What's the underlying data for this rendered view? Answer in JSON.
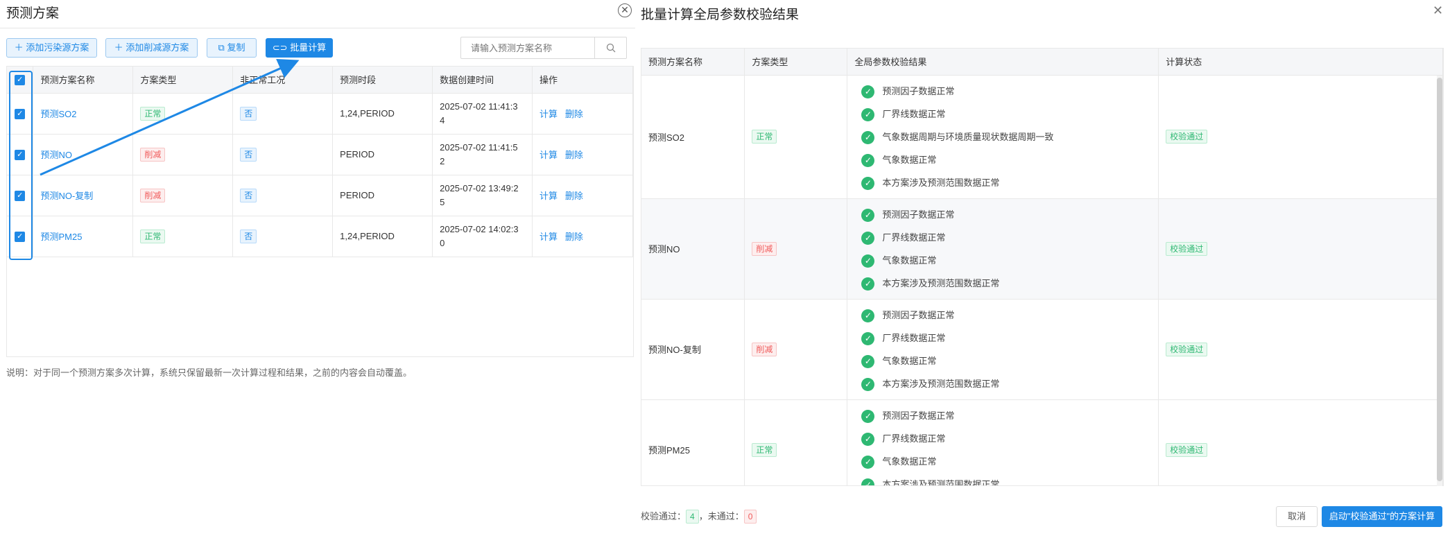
{
  "left_panel": {
    "title": "预测方案",
    "toolbar": {
      "add_pollution": "添加污染源方案",
      "add_reduction": "添加削减源方案",
      "copy": "复制",
      "batch_calc": "批量计算"
    },
    "search": {
      "placeholder": "请输入预测方案名称"
    },
    "columns": [
      "预测方案名称",
      "方案类型",
      "非正常工况",
      "预测时段",
      "数据创建时间",
      "操作"
    ],
    "rows": [
      {
        "name": "预测SO2",
        "type": "正常",
        "type_color": "green",
        "abnormal": "否",
        "period": "1,24,PERIOD",
        "created_l1": "2025-07-02 11:41:3",
        "created_l2": "4",
        "action_calc": "计算",
        "action_delete": "删除"
      },
      {
        "name": "预测NO",
        "type": "削减",
        "type_color": "red",
        "abnormal": "否",
        "period": "PERIOD",
        "created_l1": "2025-07-02 11:41:5",
        "created_l2": "2",
        "action_calc": "计算",
        "action_delete": "删除"
      },
      {
        "name": "预测NO-复制",
        "type": "削减",
        "type_color": "red",
        "abnormal": "否",
        "period": "PERIOD",
        "created_l1": "2025-07-02 13:49:2",
        "created_l2": "5",
        "action_calc": "计算",
        "action_delete": "删除"
      },
      {
        "name": "预测PM25",
        "type": "正常",
        "type_color": "green",
        "abnormal": "否",
        "period": "1,24,PERIOD",
        "created_l1": "2025-07-02 14:02:3",
        "created_l2": "0",
        "action_calc": "计算",
        "action_delete": "删除"
      }
    ],
    "note": "说明：对于同一个预测方案多次计算，系统只保留最新一次计算过程和结果，之前的内容会自动覆盖。"
  },
  "right_panel": {
    "title": "批量计算全局参数校验结果",
    "columns": [
      "预测方案名称",
      "方案类型",
      "全局参数校验结果",
      "计算状态"
    ],
    "rows": [
      {
        "name": "预测SO2",
        "type": "正常",
        "type_color": "green",
        "checks": [
          "预测因子数据正常",
          "厂界线数据正常",
          "气象数据周期与环境质量现状数据周期一致",
          "气象数据正常",
          "本方案涉及预测范围数据正常"
        ],
        "status": "校验通过"
      },
      {
        "name": "预测NO",
        "type": "削减",
        "type_color": "red",
        "checks": [
          "预测因子数据正常",
          "厂界线数据正常",
          "气象数据正常",
          "本方案涉及预测范围数据正常"
        ],
        "status": "校验通过"
      },
      {
        "name": "预测NO-复制",
        "type": "削减",
        "type_color": "red",
        "checks": [
          "预测因子数据正常",
          "厂界线数据正常",
          "气象数据正常",
          "本方案涉及预测范围数据正常"
        ],
        "status": "校验通过"
      },
      {
        "name": "预测PM25",
        "type": "正常",
        "type_color": "green",
        "checks": [
          "预测因子数据正常",
          "厂界线数据正常",
          "气象数据正常",
          "本方案涉及预测范围数据正常"
        ],
        "status": "校验通过"
      }
    ],
    "summary": {
      "passed_label": "校验通过：",
      "passed_count": "4",
      "separator": "，",
      "failed_label": "未通过：",
      "failed_count": "0"
    },
    "buttons": {
      "cancel": "取消",
      "start": "启动\"校验通过\"的方案计算"
    }
  },
  "colors": {
    "accent": "#1e88e5",
    "success": "#2eb872",
    "danger": "#f05a5a"
  }
}
